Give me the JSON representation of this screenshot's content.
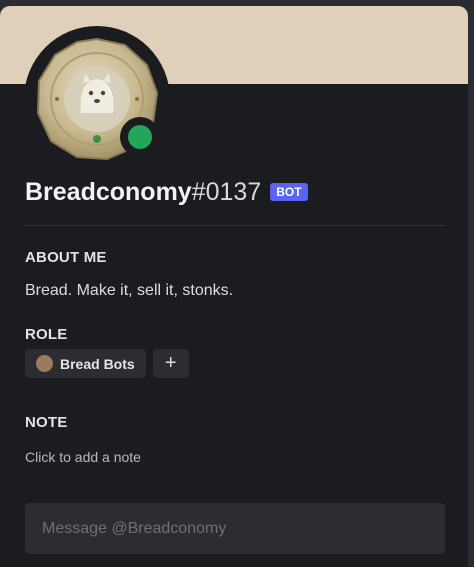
{
  "profile": {
    "username": "Breadconomy",
    "discriminator": "#0137",
    "bot_badge": "BOT",
    "status": "online",
    "banner_color": "#e0d0b9",
    "status_color": "#23a55a",
    "avatar": "pound-coin-avatar"
  },
  "about": {
    "title": "ABOUT ME",
    "text": "Bread. Make it, sell it, stonks."
  },
  "roles": {
    "title": "ROLE",
    "items": [
      {
        "label": "Bread Bots",
        "color": "#9c7a5c"
      }
    ],
    "add_label": "+"
  },
  "note": {
    "title": "NOTE",
    "placeholder": "Click to add a note"
  },
  "message": {
    "placeholder": "Message @Breadconomy"
  }
}
